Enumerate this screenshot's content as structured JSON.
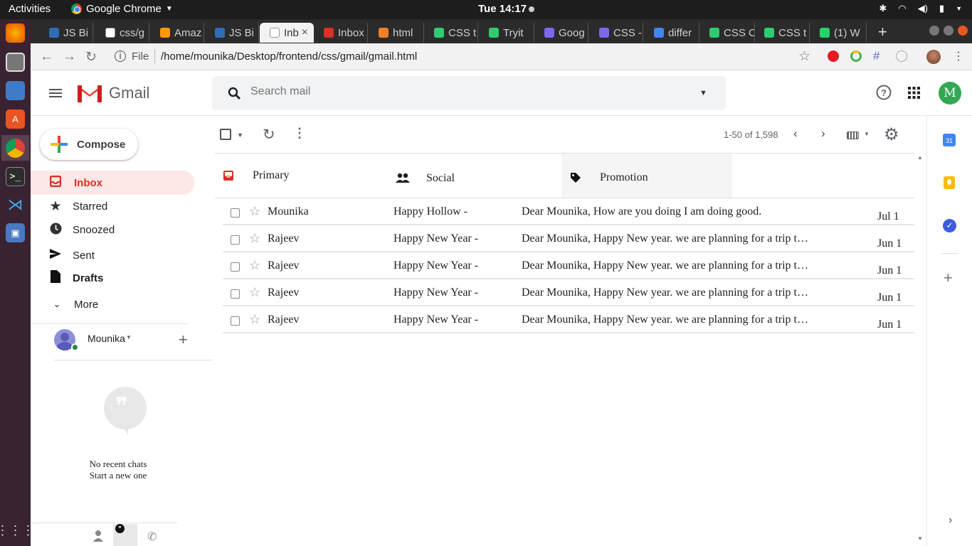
{
  "os": {
    "activities": "Activities",
    "app_name": "Google Chrome",
    "clock": "Tue 14:17"
  },
  "browser": {
    "tabs": [
      {
        "label": "JS Bi",
        "favicon_color": "#2e6db4"
      },
      {
        "label": "css/g",
        "favicon_color": "#ffffff"
      },
      {
        "label": "Amaz",
        "favicon_color": "#ff9900"
      },
      {
        "label": "JS Bi",
        "favicon_color": "#2e6db4"
      },
      {
        "label": "Inb",
        "favicon_color": "#ffffff",
        "active": true
      },
      {
        "label": "Inbox",
        "favicon_color": "#d93025"
      },
      {
        "label": "html",
        "favicon_color": "#f48024"
      },
      {
        "label": "CSS t",
        "favicon_color": "#2ecc71"
      },
      {
        "label": "Tryit",
        "favicon_color": "#2ecc71"
      },
      {
        "label": "Goog",
        "favicon_color": "#7b68ee"
      },
      {
        "label": "CSS -",
        "favicon_color": "#7b68ee"
      },
      {
        "label": "differ",
        "favicon_color": "#4285f4"
      },
      {
        "label": "CSS C",
        "favicon_color": "#2ecc71"
      },
      {
        "label": "CSS t",
        "favicon_color": "#2ecc71"
      },
      {
        "label": "(1) W",
        "favicon_color": "#25d366"
      }
    ],
    "file_label": "File",
    "url": "/home/mounika/Desktop/frontend/css/gmail/gmail.html"
  },
  "gmail": {
    "logo_text": "Gmail",
    "search_placeholder": "Search mail",
    "avatar_letter": "M",
    "compose_label": "Compose",
    "nav": [
      {
        "label": "Inbox",
        "icon": "inbox-icon"
      },
      {
        "label": "Starred",
        "icon": "star-icon"
      },
      {
        "label": "Snoozed",
        "icon": "clock-icon"
      },
      {
        "label": "Sent",
        "icon": "send-icon"
      },
      {
        "label": "Drafts",
        "icon": "draft-icon"
      },
      {
        "label": "More",
        "icon": "chevron-down-icon"
      }
    ],
    "hangouts": {
      "user_name": "Mounika",
      "no_chats": "No recent chats",
      "start_new": "Start a new one"
    },
    "pagination": "1-50 of 1,598",
    "category_tabs": [
      {
        "label": "Primary",
        "icon": "inbox-icon"
      },
      {
        "label": "Social",
        "icon": "people-icon"
      },
      {
        "label": "Promotion",
        "icon": "tag-icon"
      }
    ],
    "emails": [
      {
        "sender": "Mounika",
        "subject": "Happy Hollow -",
        "snippet": "Dear Mounika, How are you doing I am doing good.",
        "date": "Jul 1"
      },
      {
        "sender": "Rajeev",
        "subject": "Happy New Year -",
        "snippet": "Dear Mounika, Happy New year. we are planning for a trip to Goa",
        "date": "Jun 1"
      },
      {
        "sender": "Rajeev",
        "subject": "Happy New Year -",
        "snippet": "Dear Mounika, Happy New year. we are planning for a trip to Goa",
        "date": "Jun 1"
      },
      {
        "sender": "Rajeev",
        "subject": "Happy New Year -",
        "snippet": "Dear Mounika, Happy New year. we are planning for a trip to Goa",
        "date": "Jun 1"
      },
      {
        "sender": "Rajeev",
        "subject": "Happy New Year -",
        "snippet": "Dear Mounika, Happy New year. we are planning for a trip to Goa",
        "date": "Jun 1"
      }
    ]
  }
}
